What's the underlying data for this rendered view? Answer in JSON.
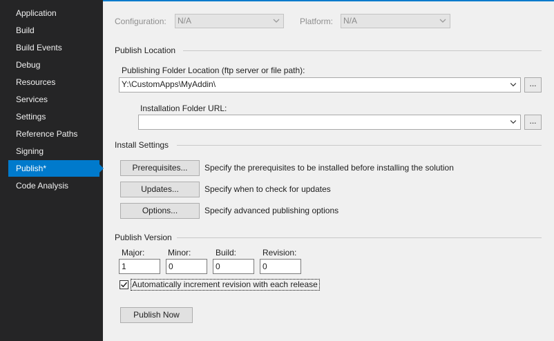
{
  "sidebar": {
    "items": [
      {
        "label": "Application"
      },
      {
        "label": "Build"
      },
      {
        "label": "Build Events"
      },
      {
        "label": "Debug"
      },
      {
        "label": "Resources"
      },
      {
        "label": "Services"
      },
      {
        "label": "Settings"
      },
      {
        "label": "Reference Paths"
      },
      {
        "label": "Signing"
      },
      {
        "label": "Publish*",
        "selected": true
      },
      {
        "label": "Code Analysis"
      }
    ]
  },
  "top": {
    "configuration_label": "Configuration:",
    "configuration_value": "N/A",
    "platform_label": "Platform:",
    "platform_value": "N/A"
  },
  "publish_location": {
    "header": "Publish Location",
    "folder_label": "Publishing Folder Location (ftp server or file path):",
    "folder_value": "Y:\\CustomApps\\MyAddin\\",
    "browse_label": "...",
    "install_url_label": "Installation Folder URL:",
    "install_url_value": "",
    "install_browse_label": "..."
  },
  "install_settings": {
    "header": "Install Settings",
    "prerequisites_button": "Prerequisites...",
    "prerequisites_desc": "Specify the prerequisites to be installed before installing the solution",
    "updates_button": "Updates...",
    "updates_desc": "Specify when to check for updates",
    "options_button": "Options...",
    "options_desc": "Specify advanced publishing options"
  },
  "publish_version": {
    "header": "Publish Version",
    "major_label": "Major:",
    "major_value": "1",
    "minor_label": "Minor:",
    "minor_value": "0",
    "build_label": "Build:",
    "build_value": "0",
    "revision_label": "Revision:",
    "revision_value": "0",
    "auto_increment_label": "Automatically increment revision with each release",
    "auto_increment_checked": true
  },
  "publish_now_button": "Publish Now",
  "colors": {
    "sidebar_bg": "#252526",
    "accent": "#007acc",
    "content_bg": "#f0f0f0"
  }
}
